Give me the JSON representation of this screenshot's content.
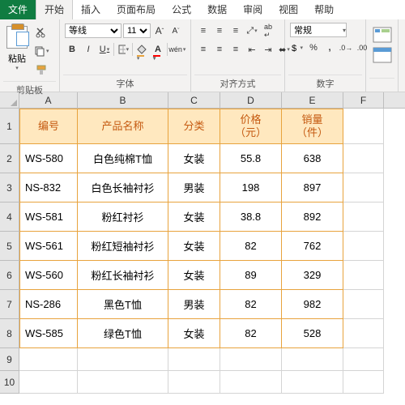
{
  "tabs": {
    "file": "文件",
    "home": "开始",
    "insert": "插入",
    "layout": "页面布局",
    "formula": "公式",
    "data": "数据",
    "review": "审阅",
    "view": "视图",
    "help": "帮助"
  },
  "ribbon": {
    "clipboard": {
      "label": "剪贴板",
      "paste": "粘贴"
    },
    "font": {
      "label": "字体",
      "family": "等线",
      "size": "11",
      "bold": "B",
      "italic": "I",
      "underline": "U",
      "growA": "A",
      "shrinkA": "A",
      "phonetic": "wén"
    },
    "align": {
      "label": "对齐方式",
      "wrap": "ab",
      "merge": "⇄"
    },
    "number": {
      "label": "数字",
      "format": "常规",
      "percent": "%",
      "comma": ","
    }
  },
  "columns": [
    "A",
    "B",
    "C",
    "D",
    "E",
    "F"
  ],
  "headers": {
    "id": "编号",
    "name": "产品名称",
    "cat": "分类",
    "price1": "价格",
    "price2": "（元）",
    "qty1": "销量",
    "qty2": "（件）"
  },
  "rows": [
    {
      "id": "WS-580",
      "name": "白色纯棉T恤",
      "cat": "女装",
      "price": "55.8",
      "qty": "638"
    },
    {
      "id": "NS-832",
      "name": "白色长袖衬衫",
      "cat": "男装",
      "price": "198",
      "qty": "897"
    },
    {
      "id": "WS-581",
      "name": "粉红衬衫",
      "cat": "女装",
      "price": "38.8",
      "qty": "892"
    },
    {
      "id": "WS-561",
      "name": "粉红短袖衬衫",
      "cat": "女装",
      "price": "82",
      "qty": "762"
    },
    {
      "id": "WS-560",
      "name": "粉红长袖衬衫",
      "cat": "女装",
      "price": "89",
      "qty": "329"
    },
    {
      "id": "NS-286",
      "name": "黑色T恤",
      "cat": "男装",
      "price": "82",
      "qty": "982"
    },
    {
      "id": "WS-585",
      "name": "绿色T恤",
      "cat": "女装",
      "price": "82",
      "qty": "528"
    }
  ]
}
